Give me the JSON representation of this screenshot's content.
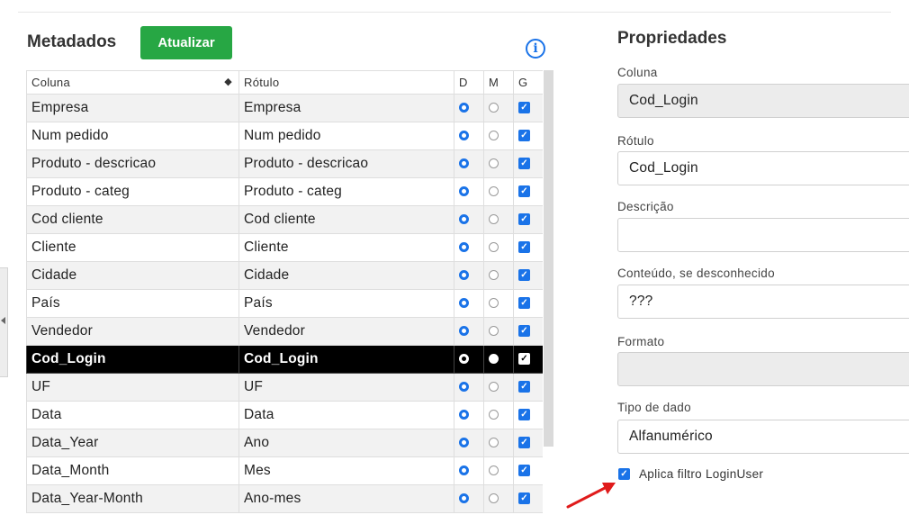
{
  "metadata_panel": {
    "title": "Metadados",
    "refresh_label": "Atualizar",
    "info_icon": "i",
    "columns": {
      "column": "Coluna",
      "label": "Rótulo",
      "d": "D",
      "m": "M",
      "g": "G"
    },
    "rows": [
      {
        "column": "Empresa",
        "label": "Empresa",
        "d": true,
        "m": false,
        "g": true
      },
      {
        "column": "Num pedido",
        "label": "Num pedido",
        "d": true,
        "m": false,
        "g": true
      },
      {
        "column": "Produto - descricao",
        "label": "Produto - descricao",
        "d": true,
        "m": false,
        "g": true
      },
      {
        "column": "Produto - categ",
        "label": "Produto - categ",
        "d": true,
        "m": false,
        "g": true
      },
      {
        "column": "Cod cliente",
        "label": "Cod cliente",
        "d": true,
        "m": false,
        "g": true
      },
      {
        "column": "Cliente",
        "label": "Cliente",
        "d": true,
        "m": false,
        "g": true
      },
      {
        "column": "Cidade",
        "label": "Cidade",
        "d": true,
        "m": false,
        "g": true
      },
      {
        "column": "País",
        "label": "País",
        "d": true,
        "m": false,
        "g": true
      },
      {
        "column": "Vendedor",
        "label": "Vendedor",
        "d": true,
        "m": false,
        "g": true
      },
      {
        "column": "Cod_Login",
        "label": "Cod_Login",
        "d": true,
        "m": false,
        "g": true,
        "selected": true
      },
      {
        "column": "UF",
        "label": "UF",
        "d": true,
        "m": false,
        "g": true
      },
      {
        "column": "Data",
        "label": "Data",
        "d": true,
        "m": false,
        "g": true
      },
      {
        "column": "Data_Year",
        "label": "Ano",
        "d": true,
        "m": false,
        "g": true
      },
      {
        "column": "Data_Month",
        "label": "Mes",
        "d": true,
        "m": false,
        "g": true
      },
      {
        "column": "Data_Year-Month",
        "label": "Ano-mes",
        "d": true,
        "m": false,
        "g": true
      }
    ]
  },
  "properties_panel": {
    "title": "Propriedades",
    "column_label": "Coluna",
    "column_value": "Cod_Login",
    "label_label": "Rótulo",
    "label_value": "Cod_Login",
    "description_label": "Descrição",
    "description_value": "",
    "unknown_label": "Conteúdo, se desconhecido",
    "unknown_value": "???",
    "format_label": "Formato",
    "format_value": "",
    "type_label": "Tipo de dado",
    "type_value": "Alfanumérico",
    "filter_checkbox_label": "Aplica filtro LoginUser",
    "filter_checked": true
  },
  "colors": {
    "accent": "#1a73e8",
    "refresh_button": "#27a744",
    "selected_row": "#000000",
    "annotation_arrow": "#e01b1b"
  }
}
